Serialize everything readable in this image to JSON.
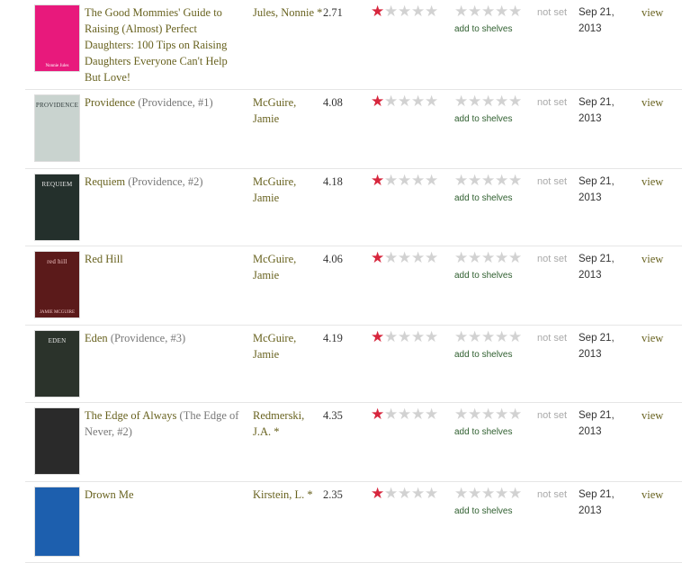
{
  "labels": {
    "not_set": "not set",
    "add_to_shelves": "add to shelves",
    "view": "view"
  },
  "colors": {
    "link": "#68621f",
    "star_on": "#d7263d",
    "star_off": "#d2d2d2",
    "shelves_link": "#2f5f2f"
  },
  "books": [
    {
      "title": "The Good Mommies' Guide to Raising (Almost) Perfect Daughters: 100 Tips on Raising Daughters Everyone Can't Help But Love!",
      "series": "",
      "author": "Jules, Nonnie *",
      "avg_rating": "2.71",
      "my_rating": 1,
      "date_added": "Sep 21, 2013",
      "cover": {
        "bg": "#e8197c",
        "fg": "#ffffff",
        "title": "",
        "author": "Nonnie Jules"
      }
    },
    {
      "title": "Providence",
      "series": " (Providence, #1)",
      "author": "McGuire, Jamie",
      "avg_rating": "4.08",
      "my_rating": 1,
      "date_added": "Sep 21, 2013",
      "cover": {
        "bg": "#c9d3cf",
        "fg": "#2f3a3a",
        "title": "PROVIDENCE",
        "author": ""
      }
    },
    {
      "title": "Requiem",
      "series": " (Providence, #2)",
      "author": "McGuire, Jamie",
      "avg_rating": "4.18",
      "my_rating": 1,
      "date_added": "Sep 21, 2013",
      "cover": {
        "bg": "#24302c",
        "fg": "#e6e6e6",
        "title": "REQUIEM",
        "author": ""
      }
    },
    {
      "title": "Red Hill",
      "series": "",
      "author": "McGuire, Jamie",
      "avg_rating": "4.06",
      "my_rating": 1,
      "date_added": "Sep 21, 2013",
      "cover": {
        "bg": "#5b1a1a",
        "fg": "#f3c7c7",
        "title": "red hill",
        "author": "JAMIE MCGUIRE"
      }
    },
    {
      "title": "Eden",
      "series": " (Providence, #3)",
      "author": "McGuire, Jamie",
      "avg_rating": "4.19",
      "my_rating": 1,
      "date_added": "Sep 21, 2013",
      "cover": {
        "bg": "#2b332b",
        "fg": "#e8e8e8",
        "title": "EDEN",
        "author": ""
      }
    },
    {
      "title": "The Edge of Always",
      "series": " (The Edge of Never, #2)",
      "author": "Redmerski, J.A. *",
      "avg_rating": "4.35",
      "my_rating": 1,
      "date_added": "Sep 21, 2013",
      "cover": {
        "bg": "#2a2a2a",
        "fg": "#ffffff",
        "title": "",
        "author": ""
      }
    },
    {
      "title": "Drown Me",
      "series": "",
      "author": "Kirstein, L. *",
      "avg_rating": "2.35",
      "my_rating": 1,
      "date_added": "Sep 21, 2013",
      "cover": {
        "bg": "#1d5fae",
        "fg": "#ffffff",
        "title": "",
        "author": ""
      }
    }
  ]
}
